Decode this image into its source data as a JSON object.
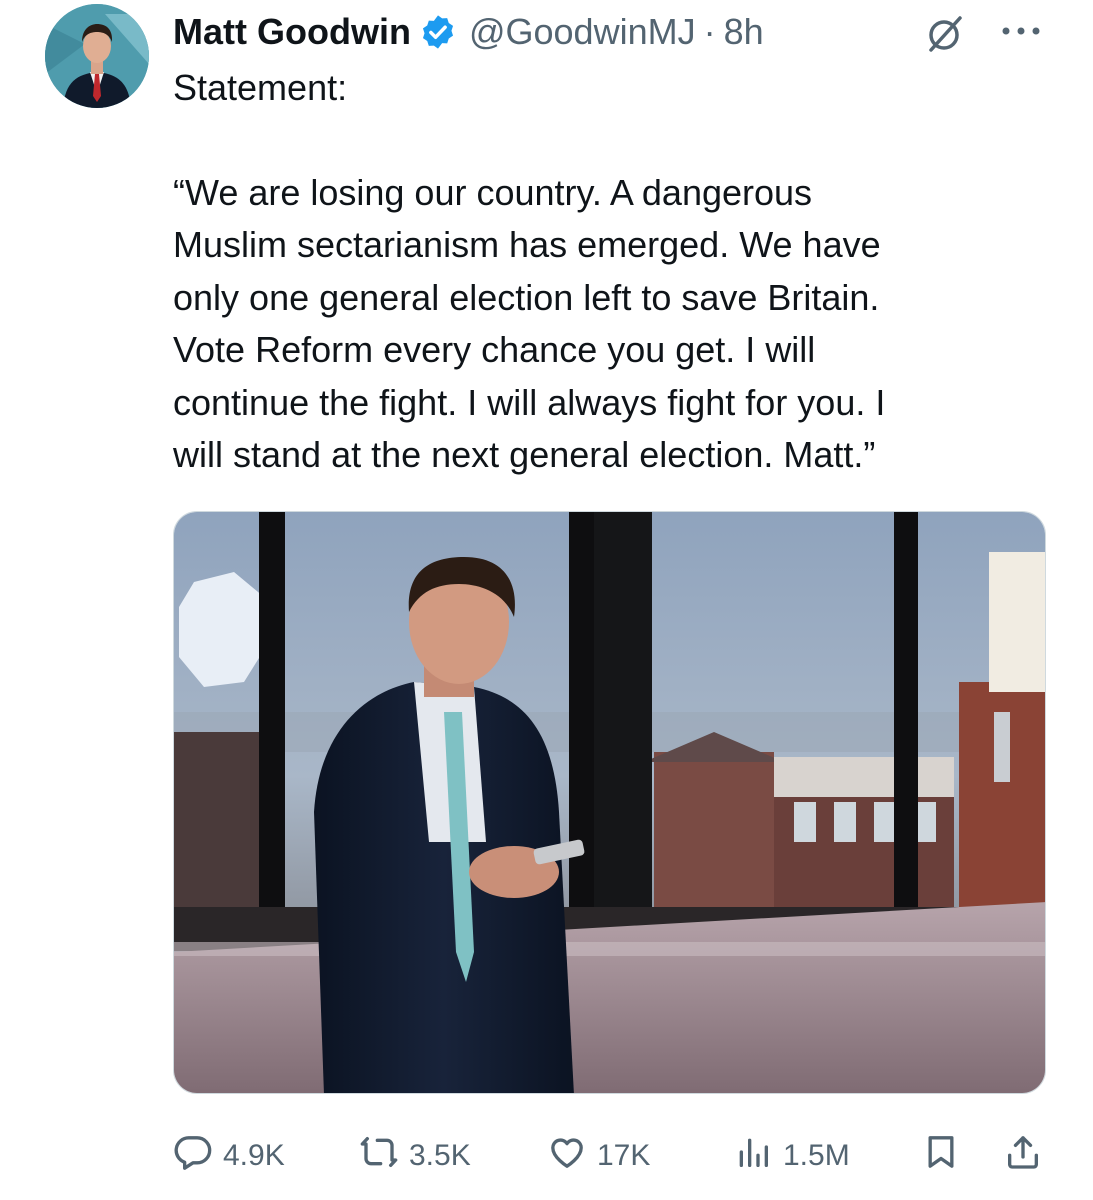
{
  "post": {
    "author_name": "Matt Goodwin",
    "handle": "@GoodwinMJ",
    "separator": "·",
    "time": "8h",
    "text_line1": "Statement:",
    "text_body": "“We are losing our country. A dangerous\nMuslim sectarianism has emerged. We have\nonly one general election left to save Britain.\nVote Reform every chance you get. I will\ncontinue the fight. I will always fight for you. I\nwill stand at the next general election. Matt.”"
  },
  "icons": {
    "verified": "verified-badge-icon",
    "grok": "grok-icon",
    "more": "more-icon",
    "reply": "reply-icon",
    "repost": "repost-icon",
    "like": "heart-icon",
    "views": "views-icon",
    "bookmark": "bookmark-icon",
    "share": "share-icon"
  },
  "metrics": {
    "replies": "4.9K",
    "reposts": "3.5K",
    "likes": "17K",
    "views": "1.5M"
  },
  "colors": {
    "text_primary": "#0f1419",
    "text_secondary": "#536471",
    "verified_blue": "#1d9bf0"
  }
}
